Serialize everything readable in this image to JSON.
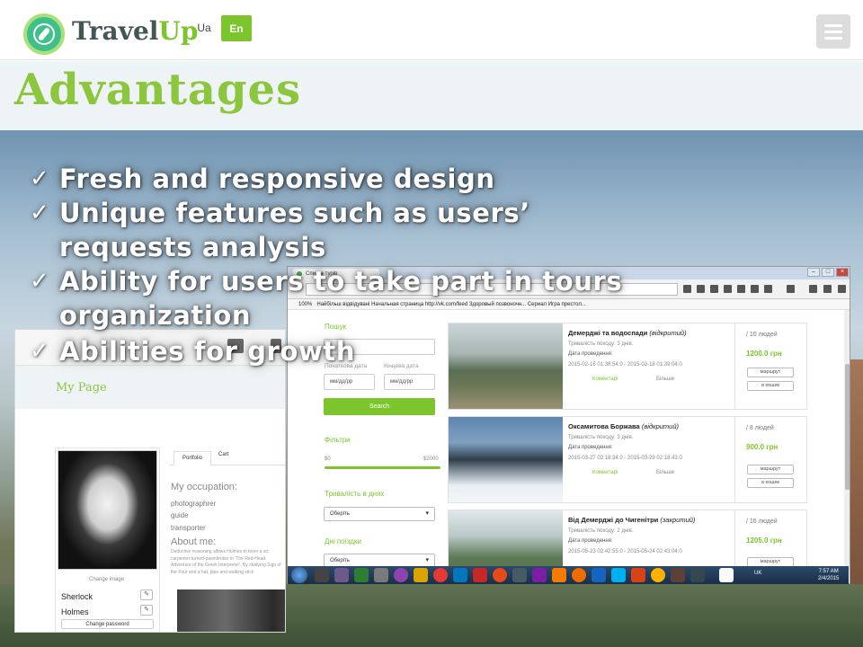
{
  "header": {
    "brand_travel": "Travel",
    "brand_up": "Up",
    "lang_ua": "Ua",
    "lang_en": "En"
  },
  "page": {
    "title": "Advantages"
  },
  "bullets": [
    {
      "line1": "Fresh and responsive design",
      "line2": ""
    },
    {
      "line1": "Unique features such as users’",
      "line2": "requests analysis"
    },
    {
      "line1": "Ability for users to take part in tours",
      "line2": "organization"
    },
    {
      "line1": "Abilities for growth",
      "line2": ""
    }
  ],
  "left_screenshot": {
    "title": "My Page",
    "change_image": "Change image",
    "first_name": "Sherlock",
    "last_name": "Holmes",
    "change_password": "Change password",
    "tab_portfolio": "Portfolio",
    "tab_cart": "Cart",
    "occupation_heading": "My occupation:",
    "occupations": [
      "photographrer",
      "guide",
      "transporter"
    ],
    "about_heading": "About me:",
    "about_text": "Deductive reasoning allows Holmes to learn a str carpenter-turned-pawnbroker in 'The Red-Head Adventure of the Greek Interpreter'. By studying Sign of the Four and a hat, pipe and walking stick"
  },
  "right_screenshot": {
    "tab_title": "Список турів",
    "zoom": "100%",
    "bookmarks": "Найбільш відвідувані  Начальная страница  http://vk.com/feed  Здоровый позвоночн...  Сериал Игра престол...",
    "search_label": "Пошук",
    "start_date_label": "Початкова дата",
    "end_date_label": "Кінцева дата",
    "date_placeholder": "мм/дд/рр",
    "search_button": "Search",
    "filters_label": "Фільтри",
    "range_min": "$0",
    "range_max": "$2000",
    "duration_label": "Тривалість в днях",
    "select_placeholder": "Оберіть",
    "trip_days_label": "Дні поїздки",
    "tours": [
      {
        "name": "Демерджі та водоспади",
        "status": "(відкритий)",
        "duration": "Тривалість походу: 3 днів.",
        "date_label": "Дата проведення:",
        "dates": "2015-02-16 01:38:54.0 - 2015-02-18 01:39:04.0",
        "comments": "Коментарі",
        "more": "Більше",
        "people": "/ 10 людей",
        "price": "1200.0 грн",
        "route_btn": "маршрут",
        "cart_btn": "в кошик"
      },
      {
        "name": "Оксамитова Боржава",
        "status": "(відкритий)",
        "duration": "Тривалість походу: 3 днів.",
        "date_label": "Дата проведення:",
        "dates": "2015-03-27 02:18:34.0 - 2015-03-29 02:18:43.0",
        "comments": "Коментарі",
        "more": "Більше",
        "people": "/ 8 людей",
        "price": "900.0 грн",
        "route_btn": "маршрут",
        "cart_btn": "в кошик"
      },
      {
        "name": "Від Демерджі до Чигенітри",
        "status": "(закритий)",
        "duration": "Тривалість походу: 2 днів.",
        "date_label": "Дата проведення:",
        "dates": "2015-05-23 02:42:55.0 - 2015-05-24 02:43:04.0",
        "comments": "",
        "more": "",
        "people": "/ 16 людей",
        "price": "1205.0 грн",
        "route_btn": "маршрут",
        "cart_btn": ""
      }
    ],
    "taskbar_lang": "UK",
    "clock_time": "7:57 AM",
    "clock_date": "2/4/2015"
  },
  "colors": {
    "accent": "#7cc52c",
    "title_green": "#8cc63f"
  }
}
